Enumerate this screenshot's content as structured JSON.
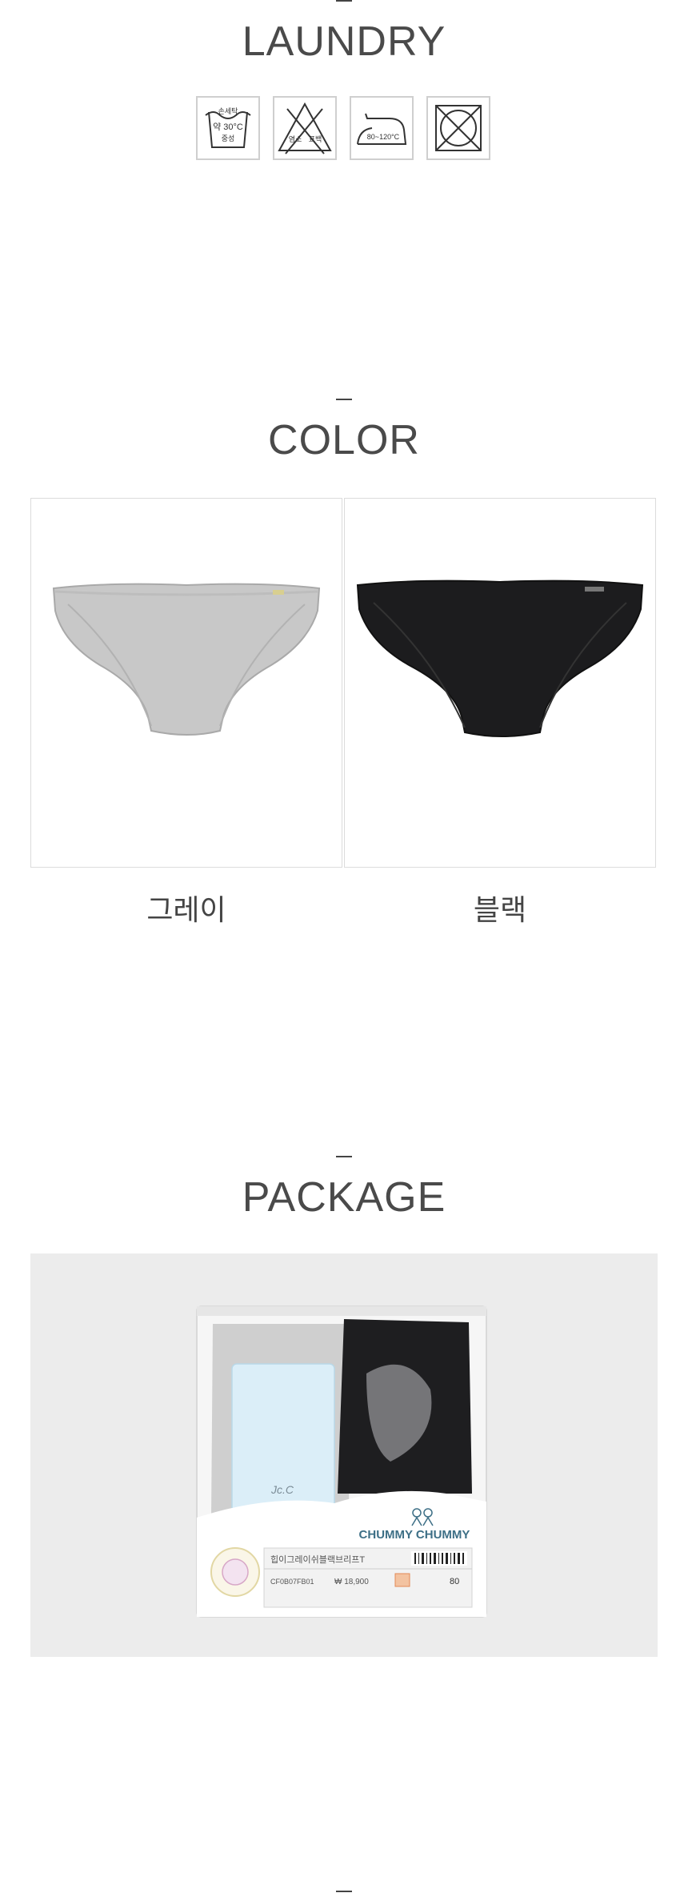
{
  "laundry": {
    "title": "LAUNDRY",
    "icons": [
      {
        "name": "hand-wash-icon",
        "line1": "손세탁",
        "line2": "약 30°C",
        "line3": "중성"
      },
      {
        "name": "no-bleach-icon",
        "left": "염소",
        "right": "표백"
      },
      {
        "name": "iron-icon",
        "temp": "80~120°C"
      },
      {
        "name": "no-tumble-dry-icon"
      }
    ]
  },
  "color": {
    "title": "COLOR",
    "options": [
      {
        "label": "그레이",
        "swatch": "#c9c9c9"
      },
      {
        "label": "블랙",
        "swatch": "#1c1c1e"
      }
    ]
  },
  "package": {
    "title": "PACKAGE",
    "brand": "CHUMMY CHUMMY",
    "product_name": "힙이그레이쉬블랙브리프T",
    "code": "CF0B07FB01",
    "price": "₩ 18,900",
    "size": "80",
    "tag_signature": "Jc.C",
    "background": "#ececec"
  }
}
